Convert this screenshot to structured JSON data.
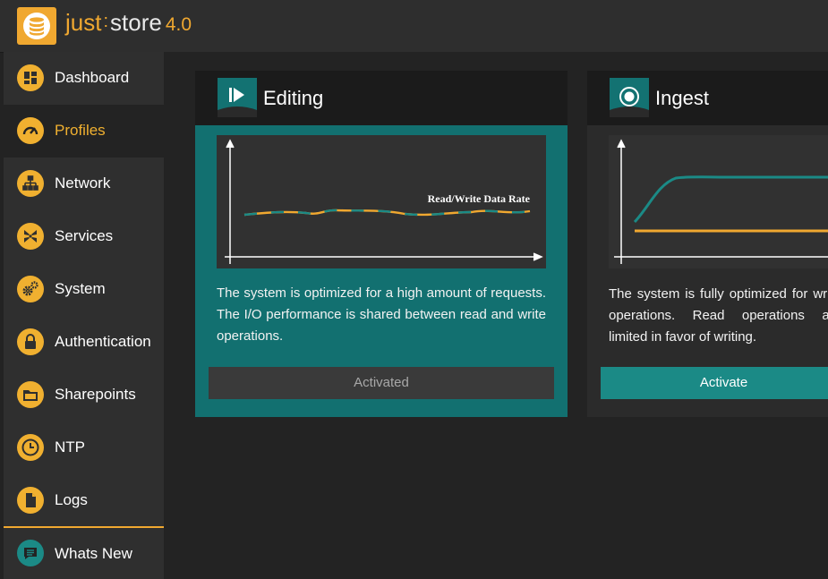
{
  "app": {
    "brand_just": "just",
    "brand_sep": ":",
    "brand_store": "store",
    "version": "4.0",
    "logo_icon": "database-icon"
  },
  "colors": {
    "accent": "#f0a830",
    "teal": "#137272",
    "teal_button": "#1b8a86",
    "sidebar_bg": "#2f2f2f",
    "main_bg": "#232323"
  },
  "sidebar": {
    "items": [
      {
        "label": "Dashboard",
        "icon": "dashboard-icon",
        "active": false
      },
      {
        "label": "Profiles",
        "icon": "gauge-icon",
        "active": true
      },
      {
        "label": "Network",
        "icon": "network-icon",
        "active": false
      },
      {
        "label": "Services",
        "icon": "services-icon",
        "active": false
      },
      {
        "label": "System",
        "icon": "gears-icon",
        "active": false
      },
      {
        "label": "Authentication",
        "icon": "lock-icon",
        "active": false
      },
      {
        "label": "Sharepoints",
        "icon": "folder-icon",
        "active": false
      },
      {
        "label": "NTP",
        "icon": "clock-icon",
        "active": false
      },
      {
        "label": "Logs",
        "icon": "file-icon",
        "active": false
      }
    ],
    "whats_new": {
      "label": "Whats New",
      "icon": "chat-icon"
    }
  },
  "profiles": [
    {
      "title": "Editing",
      "icon": "play-icon",
      "chart_label": "Read/Write Data Rate",
      "description": "The system is optimized for a high amount of requests. The I/O performance is shared between read and write operations.",
      "button_label": "Activated",
      "active": true
    },
    {
      "title": "Ingest",
      "icon": "record-icon",
      "description": "The system is fully optimized for write operations. Read operations are limited in favor of writing.",
      "button_label": "Activate",
      "active": false
    }
  ]
}
